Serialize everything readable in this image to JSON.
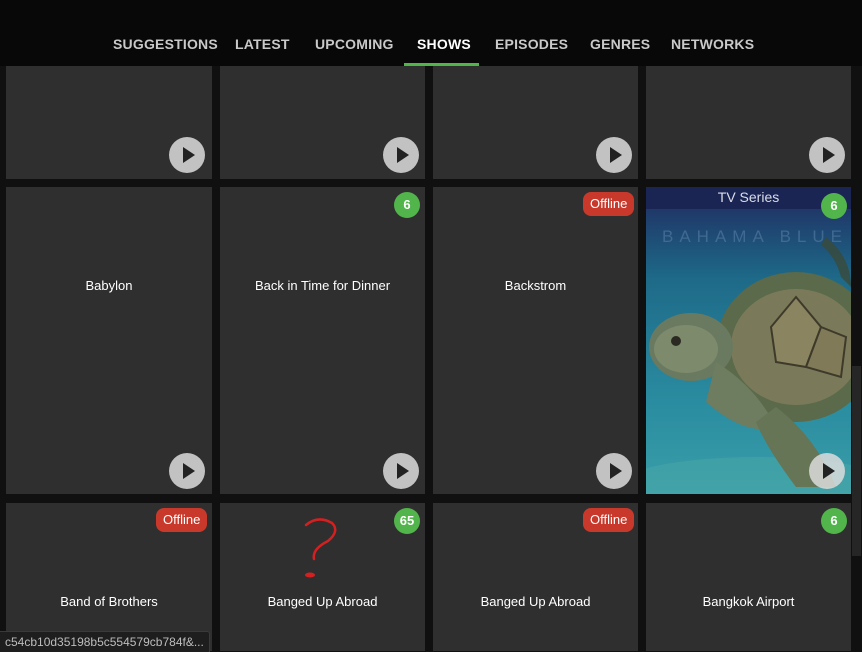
{
  "nav": {
    "tabs": [
      {
        "label": "SUGGESTIONS"
      },
      {
        "label": "LATEST"
      },
      {
        "label": "UPCOMING"
      },
      {
        "label": "SHOWS"
      },
      {
        "label": "EPISODES"
      },
      {
        "label": "GENRES"
      },
      {
        "label": "NETWORKS"
      }
    ],
    "active_tab": "SHOWS"
  },
  "row2": [
    {
      "title": "Babylon"
    },
    {
      "title": "Back in Time for Dinner",
      "badge": "6"
    },
    {
      "title": "Backstrom",
      "status": "Offline"
    },
    {
      "poster_label": "TV Series",
      "poster_brand": "BAHAMA BLUE",
      "badge": "6"
    }
  ],
  "row3": [
    {
      "title": "Band of Brothers",
      "status": "Offline"
    },
    {
      "title": "Banged Up Abroad",
      "badge": "65"
    },
    {
      "title": "Banged Up Abroad",
      "status": "Offline"
    },
    {
      "title": "Bangkok Airport",
      "badge": "6"
    }
  ],
  "status_bar": {
    "url": "c54cb10d35198b5c554579cb784f&..."
  },
  "colors": {
    "accent": "#52b54b",
    "offline": "#c8392b",
    "card": "#2f2f2f",
    "background": "#101010"
  }
}
